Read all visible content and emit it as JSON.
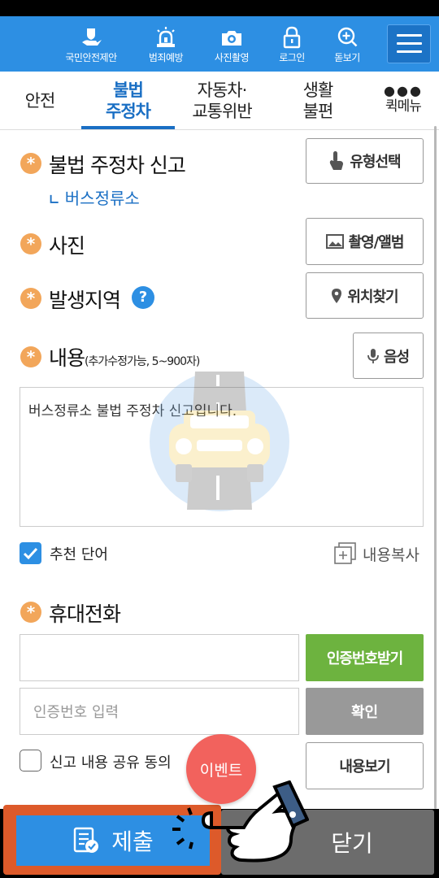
{
  "topnav": {
    "items": [
      {
        "label": "국민안전제안",
        "icon": "hand-shield-icon"
      },
      {
        "label": "범죄예방",
        "icon": "siren-icon"
      },
      {
        "label": "사진촬영",
        "icon": "camera-icon"
      },
      {
        "label": "로그인",
        "icon": "lock-icon"
      },
      {
        "label": "돋보기",
        "icon": "magnifier-plus-icon"
      }
    ],
    "menu_icon": "hamburger-icon"
  },
  "tabs": [
    {
      "label": "안전"
    },
    {
      "label": "불법\n주정차",
      "active": true
    },
    {
      "label": "자동차·\n교통위반"
    },
    {
      "label": "생활\n불편"
    },
    {
      "label": "퀵메뉴",
      "icon": "dots-icon"
    }
  ],
  "form": {
    "report_title": "불법 주정차 신고",
    "report_subtype": "버스정류소",
    "type_button": "유형선택",
    "photo_label": "사진",
    "photo_button": "촬영/앨범",
    "location_label": "발생지역",
    "location_help": "?",
    "location_button": "위치찾기",
    "content_label": "내용",
    "content_hint": "(추가수정가능, 5~900자)",
    "voice_button": "음성",
    "content_value": "버스정류소 불법 주정차 신고입니다.",
    "recommend_label": "추천 단어",
    "recommend_checked": true,
    "copy_label": "내용복사",
    "phone_label": "휴대전화",
    "phone_value": "",
    "cert_button": "인증번호받기",
    "cert_placeholder": "인증번호 입력",
    "confirm_button": "확인",
    "share_label": "신고 내용 공유 동의",
    "share_checked": false,
    "view_content_button": "내용보기",
    "required_mark": "*"
  },
  "event_badge": "이벤트",
  "bottom": {
    "submit_label": "제출",
    "close_label": "닫기"
  },
  "colors": {
    "primary": "#2d8fe3",
    "required": "#f2a65a",
    "green": "#6db33f",
    "event": "#f2625d",
    "highlight": "#dd5a2a"
  }
}
